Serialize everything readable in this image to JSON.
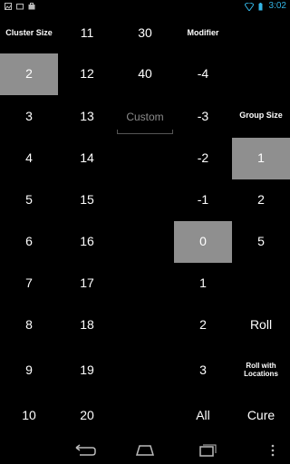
{
  "status": {
    "time": "3:02"
  },
  "cluster": {
    "header": "Cluster Size",
    "col1": [
      "2",
      "3",
      "4",
      "5",
      "6",
      "7",
      "8",
      "9",
      "10"
    ],
    "col2": [
      "11",
      "12",
      "13",
      "14",
      "15",
      "16",
      "17",
      "18",
      "19",
      "20"
    ],
    "col3": [
      "30",
      "40"
    ],
    "selected": "2",
    "custom_placeholder": "Custom"
  },
  "modifier": {
    "header": "Modifier",
    "values": [
      "-4",
      "-3",
      "-2",
      "-1",
      "0",
      "1",
      "2",
      "3",
      "All"
    ],
    "selected": "0"
  },
  "group": {
    "header": "Group Size",
    "values": [
      "1",
      "2",
      "5"
    ],
    "selected": "1"
  },
  "actions": {
    "roll": "Roll",
    "roll_with_locations": "Roll with Locations",
    "cure": "Cure"
  },
  "colors": {
    "selected_bg": "#8f8f8f",
    "accent": "#33b5e5"
  },
  "nav": {
    "icons": [
      "back-icon",
      "home-icon",
      "recent-apps-icon",
      "overflow-menu-icon"
    ]
  }
}
